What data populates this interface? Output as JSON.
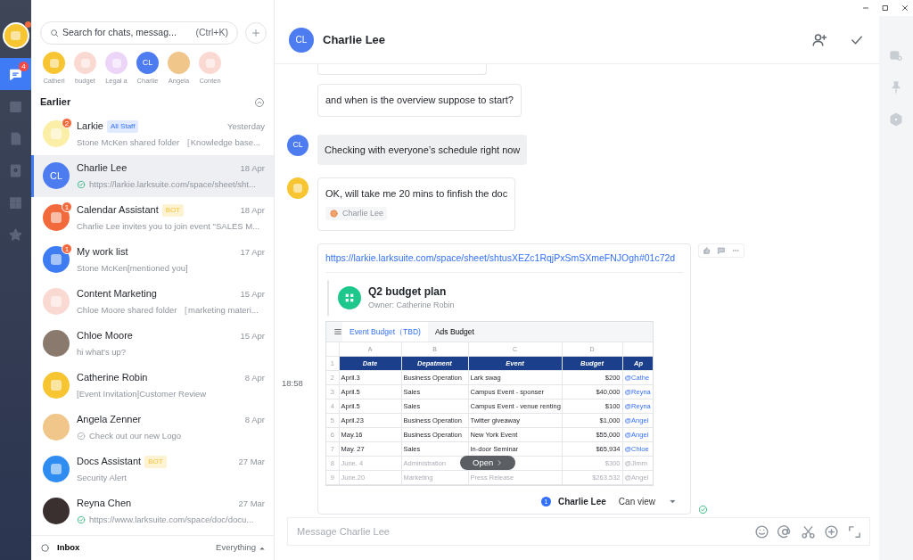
{
  "profile": {
    "notification_dot": true,
    "avatar": {
      "kind": "emblem",
      "color": "#f7c531"
    }
  },
  "rail": [
    {
      "kind": "chat",
      "selected": true,
      "badge": "4"
    },
    {
      "kind": "calendar",
      "selected": false
    },
    {
      "kind": "doc",
      "selected": false
    },
    {
      "kind": "contacts",
      "selected": false
    },
    {
      "kind": "apps",
      "selected": false
    },
    {
      "kind": "star",
      "selected": false
    }
  ],
  "search": {
    "placeholder": "Search for chats, messag...",
    "shortcut": "(Ctrl+K)"
  },
  "pinned": [
    {
      "label": "Catheri",
      "avatar": {
        "kind": "emblem",
        "color": "#f7c531"
      }
    },
    {
      "label": "budget",
      "avatar": {
        "kind": "emblem",
        "color": "#fbd9d3"
      }
    },
    {
      "label": "Legal a",
      "avatar": {
        "kind": "emblem",
        "color": "#ecd5f7"
      }
    },
    {
      "label": "Charlie",
      "avatar": {
        "kind": "initials",
        "text": "CL",
        "color": "#4c7cf0"
      }
    },
    {
      "label": "Angela",
      "avatar": {
        "kind": "photo",
        "color": "#f0c68a"
      }
    },
    {
      "label": "Conten",
      "avatar": {
        "kind": "emblem",
        "color": "#fbd9d3"
      }
    }
  ],
  "section": {
    "title": "Earlier",
    "expanded": true
  },
  "chats": [
    {
      "name": "Larkie",
      "tag": {
        "kind": "staff",
        "text": "All Staff"
      },
      "time": "Yesterday",
      "preview": "Stone McKen shared folder ［Knowledge base...",
      "unread": "2",
      "selected": false,
      "avatar": {
        "kind": "emblem",
        "color": "#fbeea6"
      }
    },
    {
      "name": "Charlie Lee",
      "time": "18 Apr",
      "read": true,
      "preview": "https://larkie.larksuite.com/space/sheet/sht...",
      "selected": true,
      "avatar": {
        "kind": "initials",
        "text": "CL",
        "color": "#4c7cf0"
      }
    },
    {
      "name": "Calendar Assistant",
      "tag": {
        "kind": "bot",
        "text": "BOT"
      },
      "time": "18 Apr",
      "preview": "Charlie Lee invites you to join event \"SALES M...",
      "unread": "1",
      "selected": false,
      "avatar": {
        "kind": "emblem",
        "color": "#f26a3c"
      }
    },
    {
      "name": "My work list",
      "time": "17 Apr",
      "preview": "Stone McKen[mentioned you]",
      "unread": "1",
      "selected": false,
      "avatar": {
        "kind": "emblem",
        "color": "#3d7cf2"
      }
    },
    {
      "name": "Content Marketing",
      "time": "15 Apr",
      "preview": "Chloe Moore shared folder ［marketing materi...",
      "selected": false,
      "avatar": {
        "kind": "emblem",
        "color": "#fbd9d3"
      }
    },
    {
      "name": "Chloe Moore",
      "time": "15 Apr",
      "preview": "hi what's up?",
      "selected": false,
      "avatar": {
        "kind": "photo",
        "color": "#8a7a6e"
      }
    },
    {
      "name": "Catherine Robin",
      "time": "8 Apr",
      "preview": "[Event Invitation]Customer Review",
      "selected": false,
      "avatar": {
        "kind": "emblem",
        "color": "#f7c531"
      }
    },
    {
      "name": "Angela Zenner",
      "time": "8 Apr",
      "read": false,
      "preview": "Check out our new Logo",
      "selected": false,
      "avatar": {
        "kind": "photo",
        "color": "#f0c68a"
      }
    },
    {
      "name": "Docs Assistant",
      "tag": {
        "kind": "bot",
        "text": "BOT"
      },
      "time": "27 Mar",
      "preview": "Security Alert",
      "selected": false,
      "avatar": {
        "kind": "emblem",
        "color": "#2f8cf0"
      }
    },
    {
      "name": "Reyna Chen",
      "time": "27 Mar",
      "read": true,
      "preview": "https://www.larksuite.com/space/doc/docu...",
      "selected": false,
      "avatar": {
        "kind": "photo",
        "color": "#3a3030"
      }
    }
  ],
  "list_footer": {
    "label": "Inbox",
    "filter": "Everything"
  },
  "chat": {
    "title": "Charlie Lee",
    "avatar": {
      "kind": "initials",
      "text": "CL",
      "color": "#4c7cf0"
    }
  },
  "messages": [
    {
      "kind": "text",
      "text": "and when is the overview suppose to start?",
      "highlighted": false
    },
    {
      "kind": "text",
      "text": "Checking with everyone’s schedule right now",
      "highlighted": true,
      "avatar": {
        "kind": "initials",
        "text": "CL",
        "color": "#4c7cf0"
      }
    },
    {
      "kind": "text",
      "text": "OK, will take me 20 mins to finfish the doc",
      "highlighted": false,
      "avatar": {
        "kind": "emblem",
        "color": "#f7c531"
      },
      "reaction": "Charlie Lee"
    },
    {
      "kind": "doc_card",
      "time": "18:58",
      "url": "https://larkie.larksuite.com/space/sheet/shtusXEZc1RqjPxSmSXmeFNJOgh#01c72d",
      "doc_title": "Q2 budget plan",
      "owner": "Owner: Catherine Robin",
      "sheet_tabs": [
        {
          "label": "Event Budget（TBD)",
          "selected": true
        },
        {
          "label": "Ads Budget",
          "selected": false
        }
      ],
      "column_letters": [
        "A",
        "B",
        "C",
        "D"
      ],
      "header_number": "1",
      "header": [
        "Date",
        "Depatment",
        "Event",
        "Budget",
        "Ap"
      ],
      "rows": [
        {
          "number": "2",
          "cells": [
            "April.3",
            "Business Operation",
            "Lark swag",
            "$200",
            "@Cathe"
          ],
          "faded": false
        },
        {
          "number": "3",
          "cells": [
            "April.5",
            "Sales",
            "Campus Event - sponser",
            "$40,000",
            "@Reyna"
          ],
          "faded": false
        },
        {
          "number": "4",
          "cells": [
            "April.5",
            "Sales",
            "Campus Event - venue renting",
            "$100",
            "@Reyna"
          ],
          "faded": false
        },
        {
          "number": "5",
          "cells": [
            "April.23",
            "Business Operation",
            "Twitter giveaway",
            "$1,000",
            "@Angel"
          ],
          "faded": false
        },
        {
          "number": "6",
          "cells": [
            "May.16",
            "Business Operation",
            "New York Event",
            "$55,000",
            "@Angel"
          ],
          "faded": false
        },
        {
          "number": "7",
          "cells": [
            "May. 27",
            "Sales",
            "In-door Seminar",
            "$65,934",
            "@Chloe"
          ],
          "faded": false
        },
        {
          "number": "8",
          "cells": [
            "June. 4",
            "Administration",
            null,
            "$300",
            "@Jimm"
          ],
          "faded": true
        },
        {
          "number": "9",
          "cells": [
            "June.20",
            "Marketing",
            "Press Release",
            "$263,532",
            "@Angel"
          ],
          "faded": true
        }
      ],
      "open_label": "Open",
      "share_count": "1",
      "share_name": "Charlie Lee",
      "permission": "Can view",
      "read": true
    }
  ],
  "composer": {
    "placeholder": "Message Charlie Lee"
  }
}
